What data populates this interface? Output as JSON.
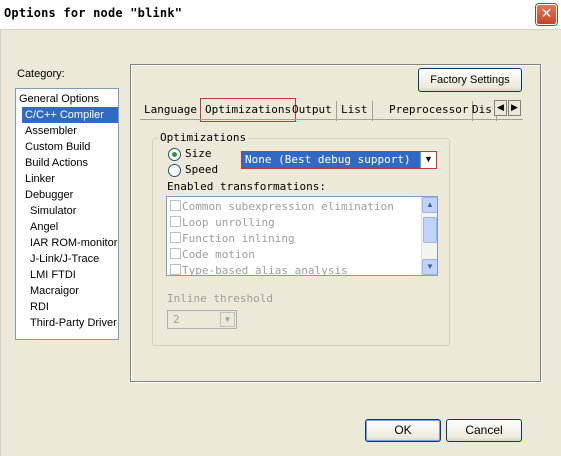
{
  "window": {
    "title": "Options for node \"blink\"",
    "close_glyph": "✕"
  },
  "category": {
    "label": "Category:",
    "items": [
      {
        "label": "General Options",
        "level": 0,
        "selected": false
      },
      {
        "label": "C/C++ Compiler",
        "level": 1,
        "selected": true
      },
      {
        "label": "Assembler",
        "level": 1,
        "selected": false
      },
      {
        "label": "Custom Build",
        "level": 1,
        "selected": false
      },
      {
        "label": "Build Actions",
        "level": 1,
        "selected": false
      },
      {
        "label": "Linker",
        "level": 1,
        "selected": false
      },
      {
        "label": "Debugger",
        "level": 1,
        "selected": false
      },
      {
        "label": "Simulator",
        "level": 2,
        "selected": false
      },
      {
        "label": "Angel",
        "level": 2,
        "selected": false
      },
      {
        "label": "IAR ROM-monitor",
        "level": 2,
        "selected": false
      },
      {
        "label": "J-Link/J-Trace",
        "level": 2,
        "selected": false
      },
      {
        "label": "LMI FTDI",
        "level": 2,
        "selected": false
      },
      {
        "label": "Macraigor",
        "level": 2,
        "selected": false
      },
      {
        "label": "RDI",
        "level": 2,
        "selected": false
      },
      {
        "label": "Third-Party Driver",
        "level": 2,
        "selected": false
      }
    ]
  },
  "factory_settings_label": "Factory Settings",
  "tabs": [
    {
      "label": "Language",
      "active": false
    },
    {
      "label": "Optimizations",
      "active": true
    },
    {
      "label": "Output",
      "active": false
    },
    {
      "label": "List",
      "active": false
    },
    {
      "label": "Preprocessor",
      "active": false
    },
    {
      "label": "Dis",
      "active": false
    }
  ],
  "tab_scroll": {
    "left": "◀",
    "right": "▶"
  },
  "optimizations": {
    "group_label": "Optimizations",
    "radio_size": "Size",
    "radio_speed": "Speed",
    "selected_radio": "Size",
    "level_value": "None (Best debug support)",
    "enabled_label": "Enabled transformations:",
    "transformations": [
      "Common subexpression elimination",
      "Loop unrolling",
      "Function inlining",
      "Code motion",
      "Type-based alias analysis"
    ],
    "inline_label": "Inline threshold",
    "inline_value": "2"
  },
  "buttons": {
    "ok": "OK",
    "cancel": "Cancel"
  }
}
